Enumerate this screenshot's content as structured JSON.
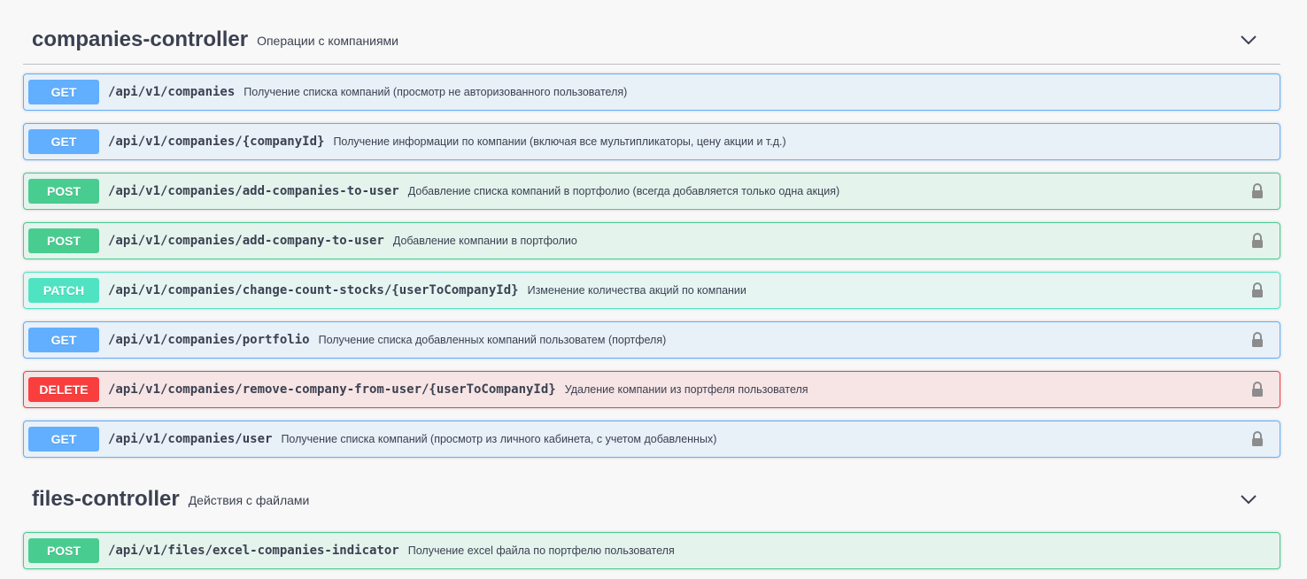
{
  "sections": [
    {
      "name": "companies-controller",
      "description": "Операции с компаниями",
      "operations": [
        {
          "method": "GET",
          "path": "/api/v1/companies",
          "summary": "Получение списка компаний (просмотр не авторизованного пользователя)",
          "locked": false
        },
        {
          "method": "GET",
          "path": "/api/v1/companies/{companyId}",
          "summary": "Получение информации по компании (включая все мультипликаторы, цену акции и т.д.)",
          "locked": false
        },
        {
          "method": "POST",
          "path": "/api/v1/companies/add-companies-to-user",
          "summary": "Добавление списка компаний в портфолио (всегда добавляется только одна акция)",
          "locked": true
        },
        {
          "method": "POST",
          "path": "/api/v1/companies/add-company-to-user",
          "summary": "Добавление компании в портфолио",
          "locked": true
        },
        {
          "method": "PATCH",
          "path": "/api/v1/companies/change-count-stocks/{userToCompanyId}",
          "summary": "Изменение количества акций по компании",
          "locked": true
        },
        {
          "method": "GET",
          "path": "/api/v1/companies/portfolio",
          "summary": "Получение списка добавленных компаний пользоватем (портфеля)",
          "locked": true
        },
        {
          "method": "DELETE",
          "path": "/api/v1/companies/remove-company-from-user/{userToCompanyId}",
          "summary": "Удаление компании из портфеля пользователя",
          "locked": true
        },
        {
          "method": "GET",
          "path": "/api/v1/companies/user",
          "summary": "Получение списка компаний (просмотр из личного кабинета, с учетом добавленных)",
          "locked": true
        }
      ]
    },
    {
      "name": "files-controller",
      "description": "Действия с файлами",
      "operations": [
        {
          "method": "POST",
          "path": "/api/v1/files/excel-companies-indicator",
          "summary": "Получение excel файла по портфелю пользователя",
          "locked": false
        }
      ]
    }
  ],
  "icons": {
    "expand": "chevron-down-icon",
    "lock": "lock-icon"
  },
  "colors": {
    "get": "#61affe",
    "post": "#49cc90",
    "patch": "#50e3c2",
    "delete": "#f93e3e"
  }
}
